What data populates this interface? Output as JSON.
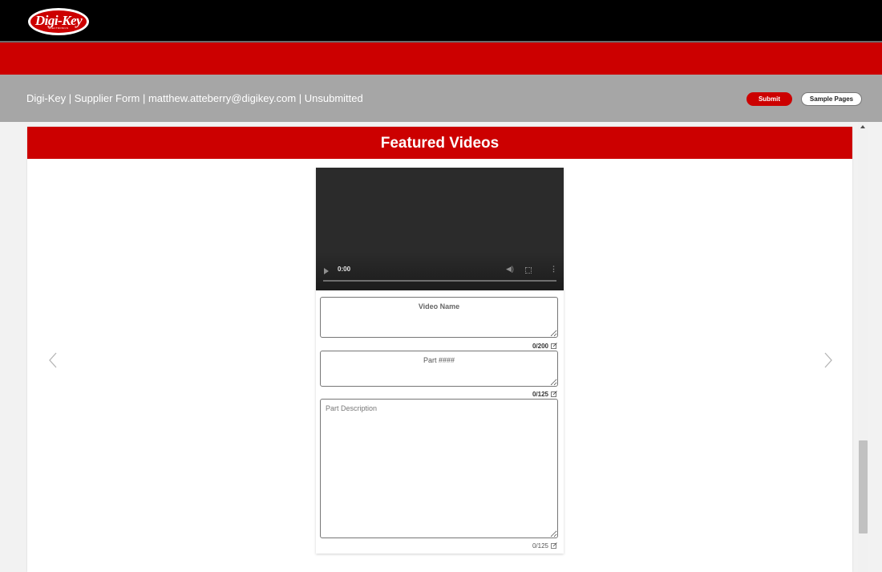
{
  "brand": {
    "logo_text": "Digi-Key",
    "logo_subtext": "ELECTRONICS",
    "colors": {
      "top_bar": "#000000",
      "brand_red": "#cc0000",
      "header_gray": "#a6a6a6"
    }
  },
  "header": {
    "info_text": "Digi-Key | Supplier Form | matthew.atteberry@digikey.com | Unsubmitted",
    "submit_label": "Submit",
    "sample_pages_label": "Sample Pages"
  },
  "section": {
    "title": "Featured Videos",
    "prev_icon": "chevron-left-icon",
    "next_icon": "chevron-right-icon"
  },
  "video": {
    "current_time": "0:00",
    "icons": [
      "play-icon",
      "volume-icon",
      "fullscreen-icon",
      "more-options-icon"
    ]
  },
  "fields": {
    "video_name": {
      "placeholder": "Video Name",
      "value": "",
      "counter": "0/200"
    },
    "part_number": {
      "placeholder": "Part ####",
      "value": "",
      "counter": "0/125"
    },
    "part_description": {
      "placeholder": "Part Description",
      "value": "",
      "counter": "0/125"
    }
  }
}
